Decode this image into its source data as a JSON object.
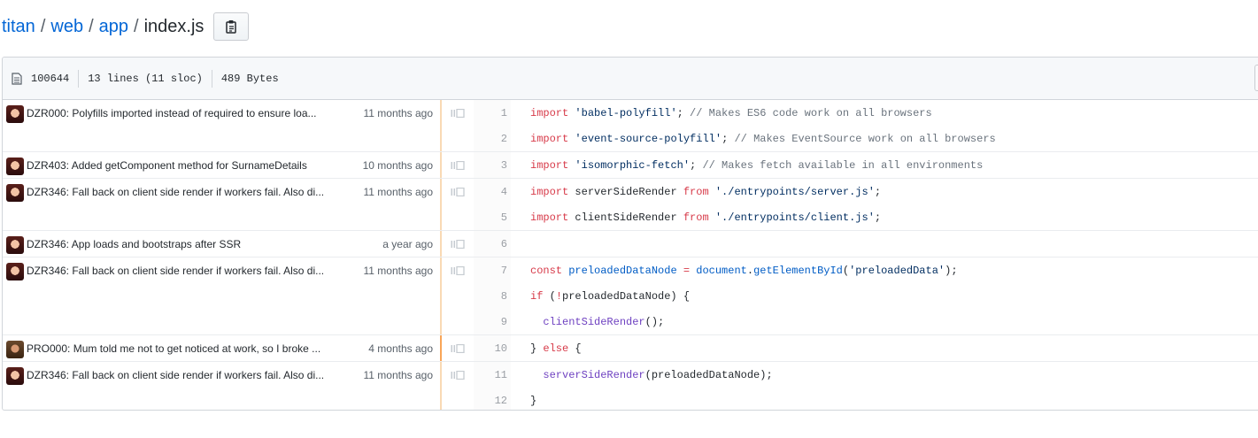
{
  "breadcrumb": {
    "repo": "titan",
    "dir1": "web",
    "dir2": "app",
    "file": "index.js",
    "separator": "/"
  },
  "file_info": {
    "mode": "100644",
    "lines": "13 lines (11 sloc)",
    "size": "489 Bytes"
  },
  "hunks": [
    {
      "message": "DZR000: Polyfills imported instead of required to ensure loa...",
      "age": "11 months ago",
      "avatar": "a1",
      "recent": false,
      "lines": [
        {
          "num": "1"
        },
        {
          "num": "2"
        }
      ]
    },
    {
      "message": "DZR403: Added getComponent method for SurnameDetails",
      "age": "10 months ago",
      "avatar": "a1",
      "recent": false,
      "lines": [
        {
          "num": "3"
        }
      ]
    },
    {
      "message": "DZR346: Fall back on client side render if workers fail. Also di...",
      "age": "11 months ago",
      "avatar": "a1",
      "recent": false,
      "lines": [
        {
          "num": "4"
        },
        {
          "num": "5"
        }
      ]
    },
    {
      "message": "DZR346: App loads and bootstraps after SSR",
      "age": "a year ago",
      "avatar": "a1",
      "recent": false,
      "lines": [
        {
          "num": "6"
        }
      ]
    },
    {
      "message": "DZR346: Fall back on client side render if workers fail. Also di...",
      "age": "11 months ago",
      "avatar": "a1",
      "recent": false,
      "lines": [
        {
          "num": "7"
        },
        {
          "num": "8"
        },
        {
          "num": "9"
        }
      ]
    },
    {
      "message": "PRO000: Mum told me not to get noticed at work, so I broke ...",
      "age": "4 months ago",
      "avatar": "a2",
      "recent": true,
      "lines": [
        {
          "num": "10"
        }
      ]
    },
    {
      "message": "DZR346: Fall back on client side render if workers fail. Also di...",
      "age": "11 months ago",
      "avatar": "a1",
      "recent": false,
      "lines": [
        {
          "num": "11"
        },
        {
          "num": "12"
        }
      ]
    }
  ],
  "code": [
    [
      {
        "t": "import",
        "c": "k"
      },
      {
        "t": " "
      },
      {
        "t": "'babel-polyfill'",
        "c": "s"
      },
      {
        "t": "; "
      },
      {
        "t": "// Makes ES6 code work on all browsers",
        "c": "c"
      }
    ],
    [
      {
        "t": "import",
        "c": "k"
      },
      {
        "t": " "
      },
      {
        "t": "'event-source-polyfill'",
        "c": "s"
      },
      {
        "t": "; "
      },
      {
        "t": "// Makes EventSource work on all browsers",
        "c": "c"
      }
    ],
    [
      {
        "t": "import",
        "c": "k"
      },
      {
        "t": " "
      },
      {
        "t": "'isomorphic-fetch'",
        "c": "s"
      },
      {
        "t": "; "
      },
      {
        "t": "// Makes fetch available in all environments",
        "c": "c"
      }
    ],
    [
      {
        "t": "import",
        "c": "k"
      },
      {
        "t": " serverSideRender "
      },
      {
        "t": "from",
        "c": "k"
      },
      {
        "t": " "
      },
      {
        "t": "'./entrypoints/server.js'",
        "c": "s"
      },
      {
        "t": ";"
      }
    ],
    [
      {
        "t": "import",
        "c": "k"
      },
      {
        "t": " clientSideRender "
      },
      {
        "t": "from",
        "c": "k"
      },
      {
        "t": " "
      },
      {
        "t": "'./entrypoints/client.js'",
        "c": "s"
      },
      {
        "t": ";"
      }
    ],
    [
      {
        "t": ""
      }
    ],
    [
      {
        "t": "const",
        "c": "k"
      },
      {
        "t": " "
      },
      {
        "t": "preloadedDataNode",
        "c": "v"
      },
      {
        "t": " "
      },
      {
        "t": "=",
        "c": "k"
      },
      {
        "t": " "
      },
      {
        "t": "document",
        "c": "v"
      },
      {
        "t": "."
      },
      {
        "t": "getElementById",
        "c": "v"
      },
      {
        "t": "("
      },
      {
        "t": "'preloadedData'",
        "c": "s"
      },
      {
        "t": ");"
      }
    ],
    [
      {
        "t": "if",
        "c": "k"
      },
      {
        "t": " ("
      },
      {
        "t": "!",
        "c": "k"
      },
      {
        "t": "preloadedDataNode) {"
      }
    ],
    [
      {
        "t": "  "
      },
      {
        "t": "clientSideRender",
        "c": "f"
      },
      {
        "t": "();"
      }
    ],
    [
      {
        "t": "} "
      },
      {
        "t": "else",
        "c": "k"
      },
      {
        "t": " {"
      }
    ],
    [
      {
        "t": "  "
      },
      {
        "t": "serverSideRender",
        "c": "f"
      },
      {
        "t": "(preloadedDataNode);"
      }
    ],
    [
      {
        "t": "}"
      }
    ]
  ]
}
